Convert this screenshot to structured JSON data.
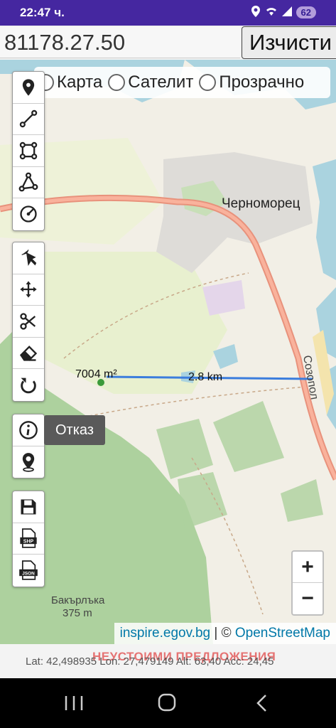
{
  "status_bar": {
    "time": "22:47 ч.",
    "battery": "62"
  },
  "top": {
    "coordinate_value": "81178.27.50",
    "clear_label": "Изчисти"
  },
  "layers": {
    "options": [
      "Карта",
      "Сателит",
      "Прозрачно"
    ],
    "selected": "Карта"
  },
  "toolbars": {
    "draw": [
      "marker-icon",
      "line-icon",
      "polygon-icon",
      "polyline-icon",
      "circle-icon"
    ],
    "edit": [
      "select-icon",
      "move-icon",
      "cut-icon",
      "eraser-icon",
      "undo-icon"
    ],
    "info": [
      "info-icon",
      "gps-marker-icon"
    ],
    "export": [
      "save-icon",
      "shp-file-icon",
      "json-file-icon"
    ]
  },
  "tooltip": "Отказ",
  "map": {
    "town_label": "Черноморец",
    "road_label": "Созопол",
    "peak_name": "Бакърлъка",
    "peak_elevation": "375 m",
    "area_measure": "7004 m²",
    "distance_measure": "2.8 km",
    "colors": {
      "sea": "#aad3df",
      "land": "#f2efe6",
      "forest": "#add19e",
      "road": "#e8927c",
      "measure_line": "#3b7ddd"
    }
  },
  "zoom": {
    "in_label": "+",
    "out_label": "−"
  },
  "attribution": {
    "inspire": "inspire.egov.bg",
    "separator": " | © ",
    "osm": "OpenStreetMap"
  },
  "info_bar": {
    "ad": "НЕУСТОИМИ ПРЕДЛОЖЕНИЯ",
    "location": "Lat: 42,498935 Lon: 27,479149 Alt: 63,40 Acc: 24,45"
  }
}
